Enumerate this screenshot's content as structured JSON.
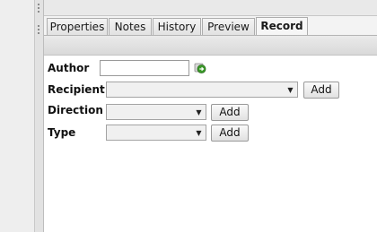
{
  "tabs": [
    {
      "label": "Properties"
    },
    {
      "label": "Notes"
    },
    {
      "label": "History"
    },
    {
      "label": "Preview"
    },
    {
      "label": "Record",
      "active": true
    }
  ],
  "form": {
    "author": {
      "label": "Author",
      "value": ""
    },
    "recipient": {
      "label": "Recipient",
      "selected": "",
      "add_label": "Add"
    },
    "direction": {
      "label": "Direction",
      "selected": "",
      "add_label": "Add"
    },
    "type": {
      "label": "Type",
      "selected": "",
      "add_label": "Add"
    }
  },
  "icons": {
    "author_action": "green-arrow-icon",
    "dropdown": "triangle-down-icon"
  },
  "colors": {
    "icon_green": "#3c9a2a",
    "tab_border": "#adadad"
  }
}
